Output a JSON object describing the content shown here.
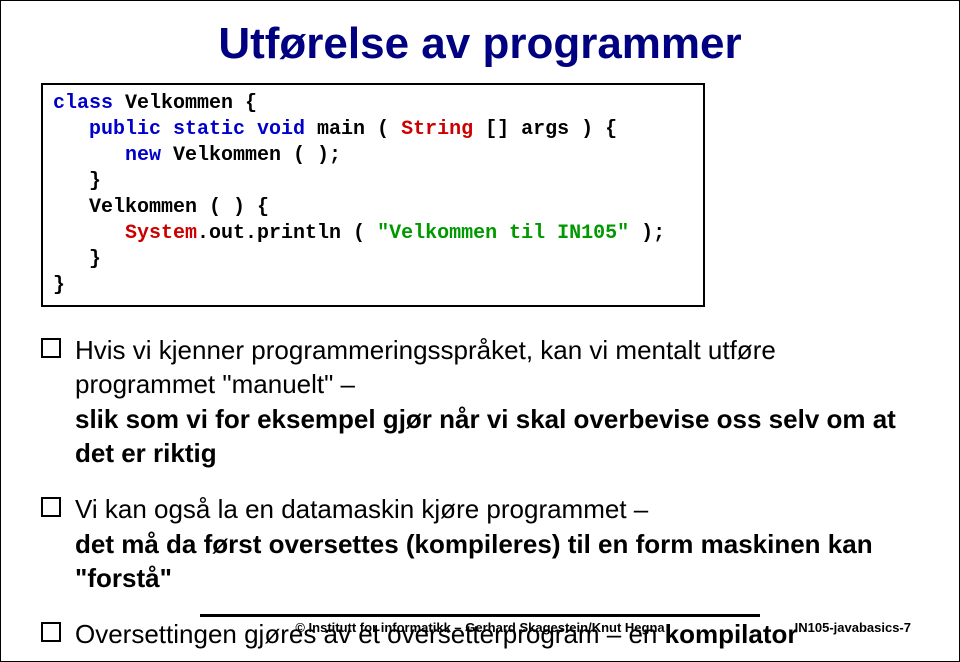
{
  "title": "Utførelse av programmer",
  "code": {
    "l1_a": "class",
    "l1_b": " Velkommen {",
    "l2_a": "   public static void",
    "l2_b": " main ( ",
    "l2_c": "String",
    "l2_d": " [] args ) {",
    "l3_a": "      new",
    "l3_b": " Velkommen ( );",
    "l4": "   }",
    "l5": "   Velkommen ( ) {",
    "l6_a": "      System",
    "l6_b": ".out.println ( ",
    "l6_c": "\"Velkommen til IN105\"",
    "l6_d": " );",
    "l7": "   }",
    "l8": "}"
  },
  "bullets": [
    {
      "parts": [
        {
          "t": "Hvis vi kjenner programmeringsspråket, kan vi mentalt utføre programmet \"manuelt\" –",
          "b": false
        },
        {
          "t": "\nslik som vi for eksempel gjør når vi skal overbevise oss selv om at det er riktig",
          "b": true
        }
      ]
    },
    {
      "parts": [
        {
          "t": "Vi kan også la en datamaskin kjøre programmet –",
          "b": false
        },
        {
          "t": "\ndet må da først ",
          "b": true
        },
        {
          "t": "oversettes",
          "b": true
        },
        {
          "t": " (kompileres) til en form maskinen kan \"forstå\"",
          "b": true
        }
      ]
    },
    {
      "parts": [
        {
          "t": "Oversettingen gjøres av et oversetterprogram – en ",
          "b": false
        },
        {
          "t": "kompilator",
          "b": true
        }
      ]
    }
  ],
  "footer_center": "© Institutt for informatikk – Gerhard Skagestein/Knut Hegna",
  "footer_right": "IN105-javabasics-7"
}
